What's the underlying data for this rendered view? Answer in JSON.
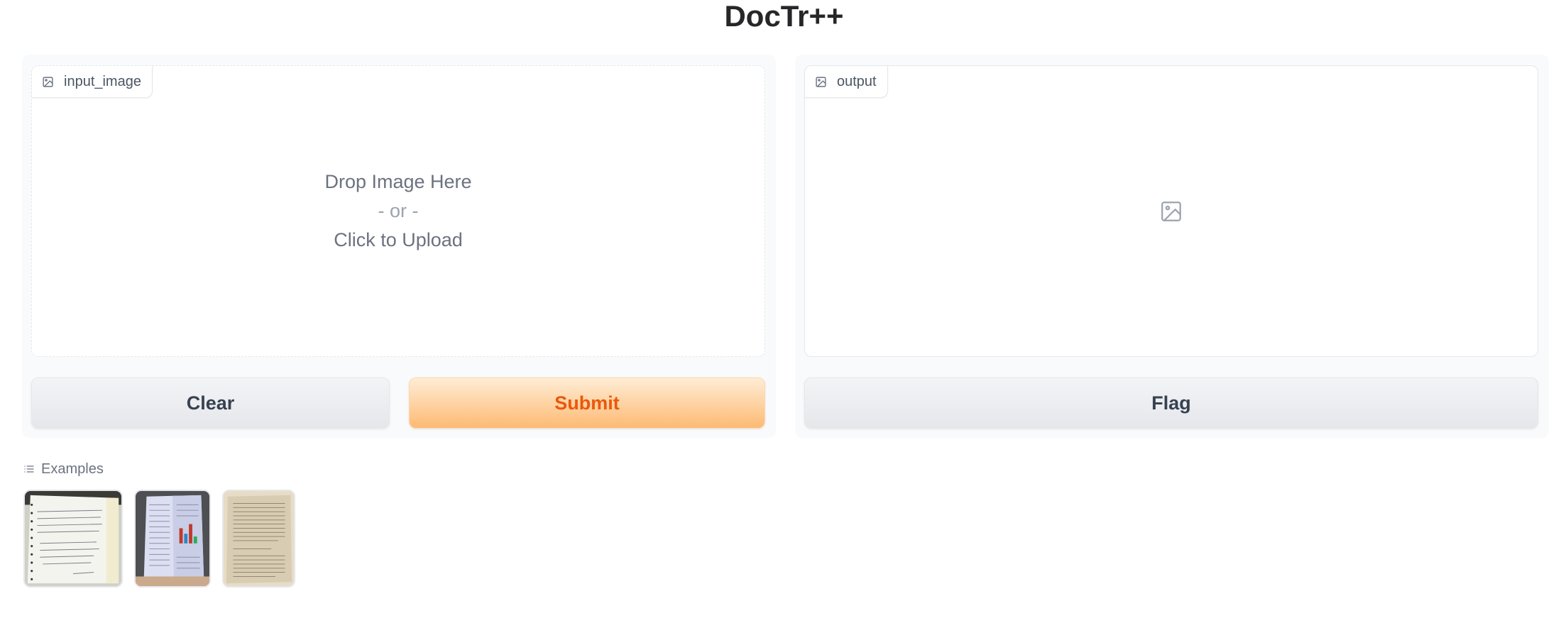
{
  "app": {
    "title": "DocTr++"
  },
  "input_panel": {
    "label": "input_image",
    "drop_text": "Drop Image Here",
    "or_text": "- or -",
    "upload_text": "Click to Upload",
    "label_icon": "image-icon"
  },
  "output_panel": {
    "label": "output",
    "label_icon": "image-icon",
    "placeholder_icon": "image-icon"
  },
  "buttons": {
    "clear": "Clear",
    "submit": "Submit",
    "flag": "Flag"
  },
  "examples": {
    "label": "Examples",
    "icon": "list-icon",
    "items": [
      {
        "name": "handwritten-notebook-page"
      },
      {
        "name": "folded-printed-document-with-chart"
      },
      {
        "name": "printed-text-page-beige"
      }
    ]
  },
  "colors": {
    "accent": "#ea580c",
    "primary_button_top": "#ffedd5",
    "primary_button_bottom": "#fdba74",
    "panel_background": "#f9fafb",
    "border": "#e5e7eb"
  }
}
